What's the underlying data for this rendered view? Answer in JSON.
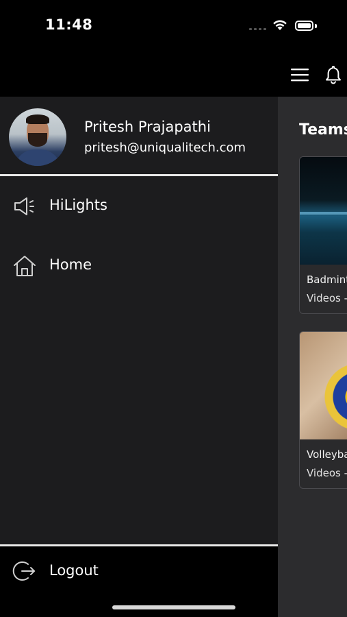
{
  "status_bar": {
    "time": "11:48",
    "icons": [
      "cellular-signal-icon",
      "wifi-icon",
      "battery-icon"
    ]
  },
  "app_bar": {
    "icons": [
      "hamburger-menu-icon",
      "bell-icon"
    ]
  },
  "background_content": {
    "title": "Teams",
    "cards": [
      {
        "name": "Badminton",
        "subtitle": "Videos - "
      },
      {
        "name": "Volleyball",
        "subtitle": "Videos - "
      }
    ]
  },
  "drawer": {
    "profile": {
      "name": "Pritesh Prajapathi",
      "email": "pritesh@uniqualitech.com"
    },
    "items": [
      {
        "label": "HiLights",
        "icon": "megaphone-icon"
      },
      {
        "label": "Home",
        "icon": "home-icon"
      }
    ],
    "logout": {
      "label": "Logout",
      "icon": "logout-icon"
    }
  },
  "colors": {
    "drawer_background": "#1c1c1e",
    "app_background": "#000000",
    "content_background": "#2c2c2e",
    "divider": "#e8e8e8",
    "text": "#ffffff"
  }
}
